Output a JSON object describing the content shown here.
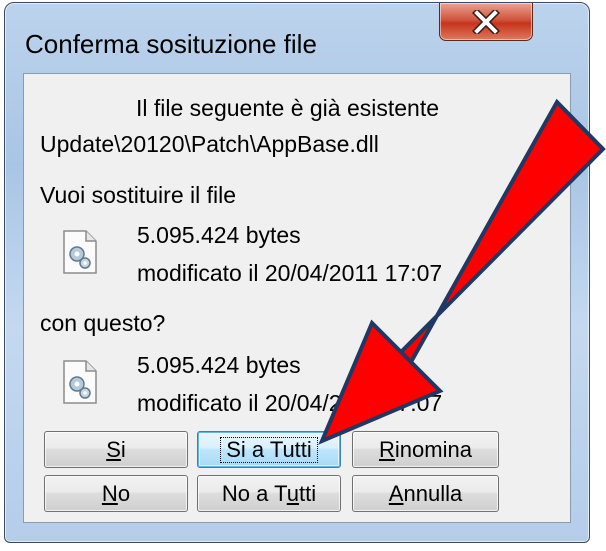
{
  "window": {
    "title": "Conferma sosituzione file",
    "close_glyph": "x"
  },
  "message": {
    "line1": "Il file seguente è già esistente",
    "path": "Update\\20120\\Patch\\AppBase.dll",
    "question_replace": "Vuoi sostituire il file",
    "existing": {
      "size": "5.095.424 bytes",
      "modified": "modificato il 20/04/2011 17:07"
    },
    "question_with": "con questo?",
    "new": {
      "size": "5.095.424 bytes",
      "modified": "modificato il 20/04/2011 17:07"
    }
  },
  "buttons": {
    "yes": {
      "pre": "",
      "mnemonic": "S",
      "post": "i"
    },
    "yes_all": {
      "pre": "",
      "mnemonic": "",
      "post": "Si a Tutti"
    },
    "rename": {
      "pre": "",
      "mnemonic": "R",
      "post": "inomina"
    },
    "no": {
      "pre": "",
      "mnemonic": "N",
      "post": "o"
    },
    "no_all": {
      "pre": "No a T",
      "mnemonic": "u",
      "post": "tti"
    },
    "cancel": {
      "pre": "",
      "mnemonic": "A",
      "post": "nnulla"
    }
  },
  "colors": {
    "arrow_fill": "#ff0000",
    "arrow_stroke": "#1f3864"
  },
  "icons": {
    "file": "config-file-icon",
    "arrow": "red-arrow-annotation"
  }
}
